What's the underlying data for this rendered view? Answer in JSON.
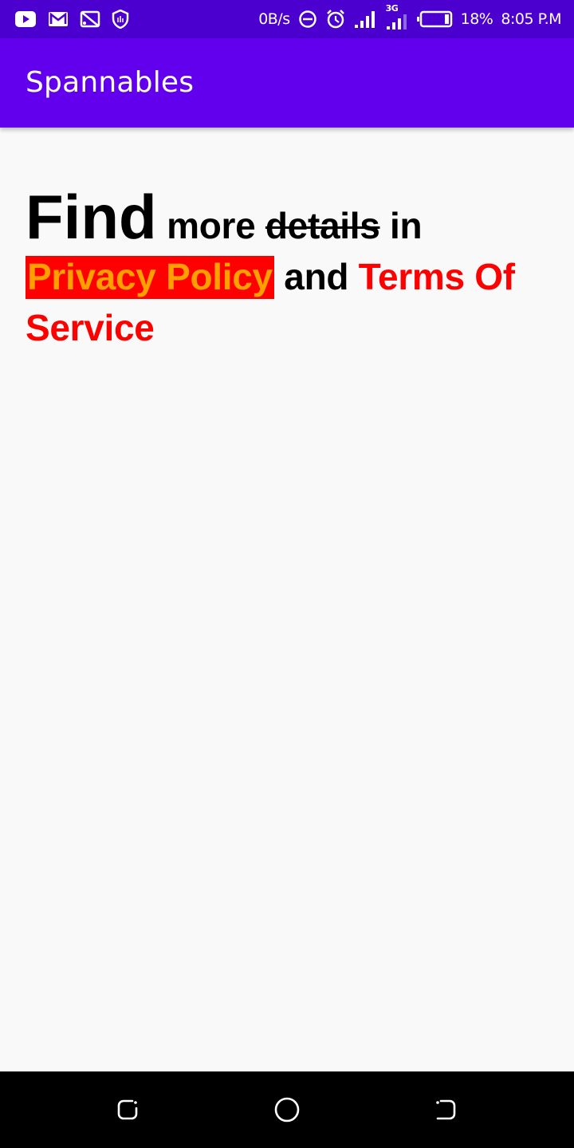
{
  "status_bar": {
    "network_speed": "0B/s",
    "network_type": "3G",
    "battery_level": "18%",
    "time": "8:05 P.M",
    "icons": [
      "youtube-icon",
      "gmail-icon",
      "cast-icon",
      "shield-icon",
      "do-not-disturb-icon",
      "alarm-icon",
      "signal-icon",
      "signal-3g-icon",
      "battery-icon"
    ]
  },
  "app_bar": {
    "title": "Spannables"
  },
  "content": {
    "find": "Find",
    "more": "more",
    "details": "details",
    "in": "in",
    "privacy_policy": "Privacy Policy",
    "and": "and",
    "terms": "Terms Of Service"
  },
  "nav_bar": {
    "icons": [
      "recent-apps-icon",
      "home-icon",
      "back-icon"
    ]
  },
  "colors": {
    "status_bar": "#4b00cf",
    "app_bar": "#6200ee",
    "privacy_background": "#ff0000",
    "privacy_text": "#ffa000",
    "terms_text": "#ff0000"
  }
}
